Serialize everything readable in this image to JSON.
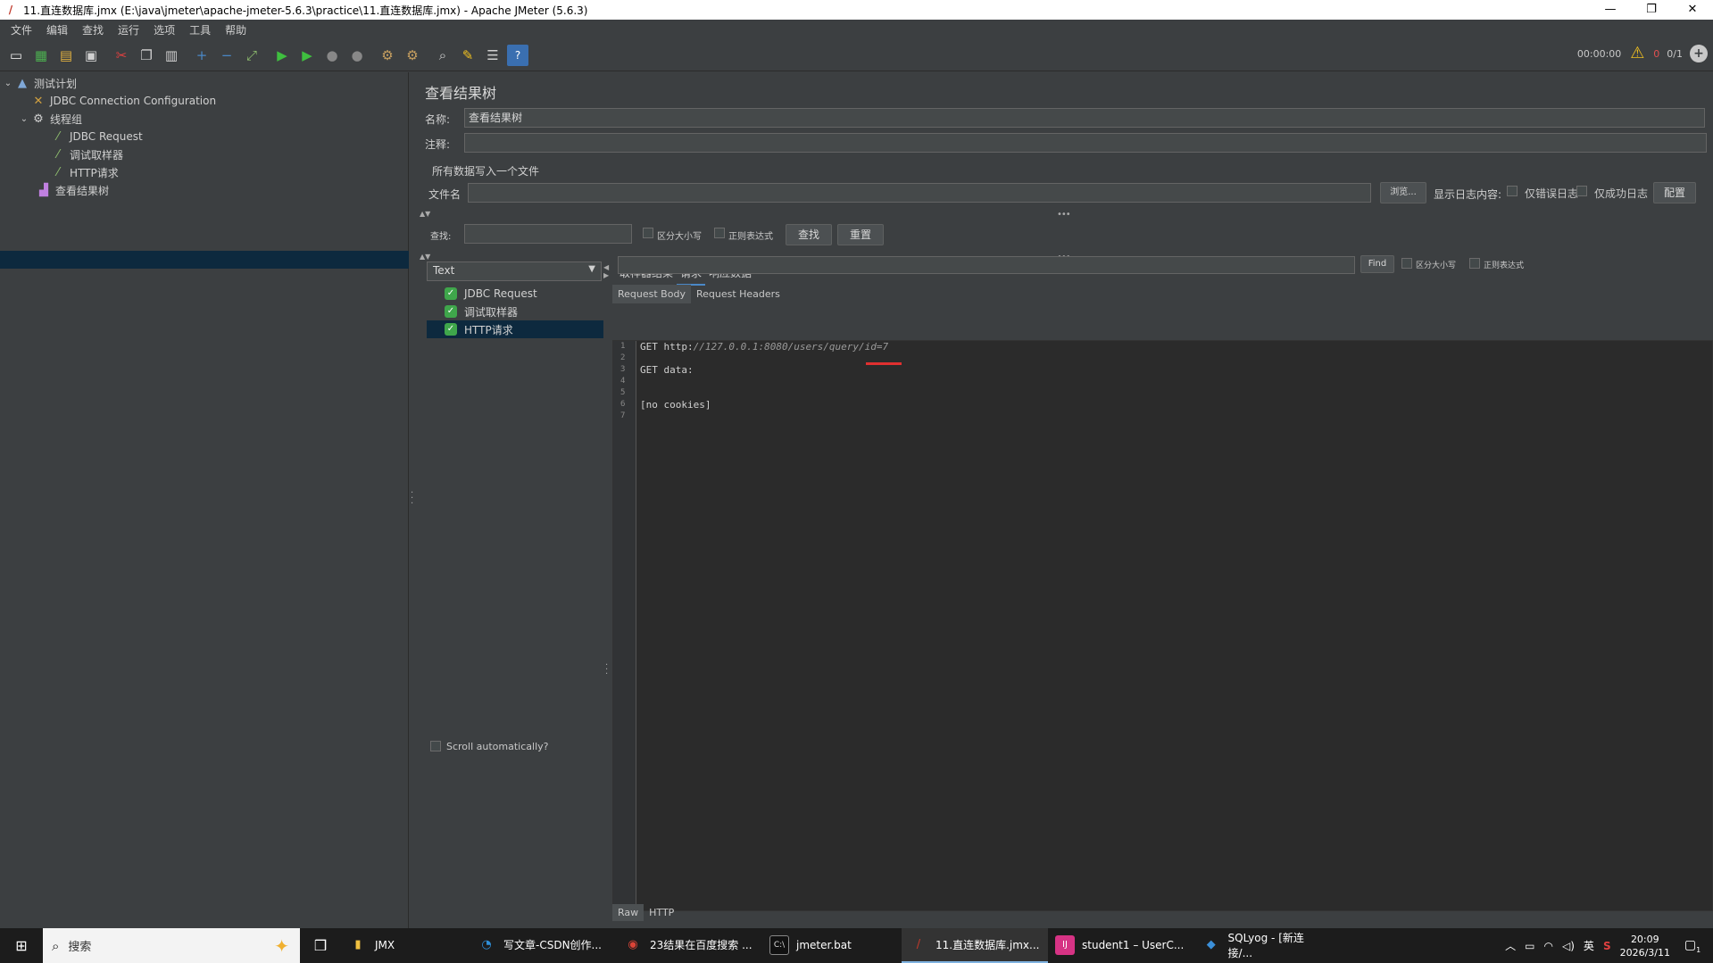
{
  "window": {
    "title": "11.直连数据库.jmx (E:\\java\\jmeter\\apache-jmeter-5.6.3\\practice\\11.直连数据库.jmx) - Apache JMeter (5.6.3)",
    "minimize": "—",
    "restore": "❐",
    "close": "✕"
  },
  "menu": [
    "文件",
    "编辑",
    "查找",
    "运行",
    "选项",
    "工具",
    "帮助"
  ],
  "toolbar": {
    "elapsed": "00:00:00",
    "error_count": "0",
    "threads": "0/1",
    "icons": [
      "new-icon",
      "templates-icon",
      "open-icon",
      "save-icon",
      "cut-icon",
      "copy-icon",
      "paste-icon",
      "expand-icon",
      "collapse-icon",
      "toggle-icon",
      "start-icon",
      "start-no-pause-icon",
      "stop-icon",
      "shutdown-icon",
      "clear-icon",
      "clear-all-icon",
      "search-icon",
      "reset-search-icon",
      "function-helper-icon",
      "help-icon"
    ]
  },
  "tree": {
    "nodes": [
      {
        "label": "测试计划",
        "icon": "test-plan-icon"
      },
      {
        "label": "JDBC Connection Configuration",
        "icon": "config-icon"
      },
      {
        "label": "线程组",
        "icon": "thread-group-icon"
      },
      {
        "label": "JDBC Request",
        "icon": "sampler-icon"
      },
      {
        "label": "调试取样器",
        "icon": "sampler-icon"
      },
      {
        "label": "HTTP请求",
        "icon": "sampler-icon"
      },
      {
        "label": "查看结果树",
        "icon": "listener-icon"
      }
    ]
  },
  "panel": {
    "title": "查看结果树",
    "name_label": "名称:",
    "name_value": "查看结果树",
    "comment_label": "注释:",
    "comment_value": "",
    "write_all_label": "所有数据写入一个文件",
    "filename_label": "文件名",
    "filename_value": "",
    "browse_button": "浏览...",
    "log_display_label": "显示日志内容:",
    "errors_only_label": "仅错误日志",
    "success_only_label": "仅成功日志",
    "configure_button": "配置",
    "search_label": "查找:",
    "search_value": "",
    "case_sensitive_label": "区分大小写",
    "regex_label": "正则表达式",
    "find_button": "查找",
    "reset_button": "重置"
  },
  "results": {
    "renderer": "Text",
    "items": [
      {
        "label": "JDBC Request",
        "status": "success"
      },
      {
        "label": "调试取样器",
        "status": "success"
      },
      {
        "label": "HTTP请求",
        "status": "success"
      }
    ],
    "scroll_auto_label": "Scroll automatically?"
  },
  "tabs": {
    "items": [
      "取样器结果",
      "请求",
      "响应数据"
    ],
    "active": "请求",
    "subtabs": [
      "Request Body",
      "Request Headers"
    ],
    "active_subtab": "Request Body",
    "find_button": "Find",
    "case_label": "区分大小写",
    "regex_label": "正则表达式",
    "bottom": [
      "Raw",
      "HTTP"
    ],
    "active_bottom": "Raw"
  },
  "editor": {
    "lines": [
      {
        "n": "1",
        "prefix": "GET http:",
        "url": "//127.0.0.1:8080/users/query/id=7"
      },
      {
        "n": "2",
        "prefix": "",
        "url": ""
      },
      {
        "n": "3",
        "prefix": "GET data:",
        "url": ""
      },
      {
        "n": "4",
        "prefix": "",
        "url": ""
      },
      {
        "n": "5",
        "prefix": "",
        "url": ""
      },
      {
        "n": "6",
        "prefix": "[no cookies]",
        "url": ""
      },
      {
        "n": "7",
        "prefix": "",
        "url": ""
      }
    ]
  },
  "taskbar": {
    "search_placeholder": "搜索",
    "apps": [
      {
        "label": "JMX",
        "icon": "folder-icon",
        "color": "#f0c040"
      },
      {
        "label": "写文章-CSDN创作...",
        "icon": "edge-icon",
        "color": "#2f8fd8"
      },
      {
        "label": "23结果在百度搜索 ...",
        "icon": "chrome-icon",
        "color": "#db4437"
      },
      {
        "label": "jmeter.bat",
        "icon": "terminal-icon",
        "color": "#444444"
      },
      {
        "label": "11.直连数据库.jmx...",
        "icon": "jmeter-icon",
        "color": "#c0392b"
      },
      {
        "label": "student1 – UserC...",
        "icon": "intellij-icon",
        "color": "#d63384"
      },
      {
        "label": "SQLyog - [新连接/...",
        "icon": "sqlyog-icon",
        "color": "#3b8fd8"
      }
    ],
    "ime": "英",
    "time": "20:09",
    "date": "2026/3/11",
    "notification_count": "1"
  },
  "colors": {
    "background": "#3c3f41",
    "selection": "#0d293e",
    "accent": "#4a88c7",
    "success": "#3fa64b",
    "warning": "#f0c020",
    "error": "#e05050"
  }
}
